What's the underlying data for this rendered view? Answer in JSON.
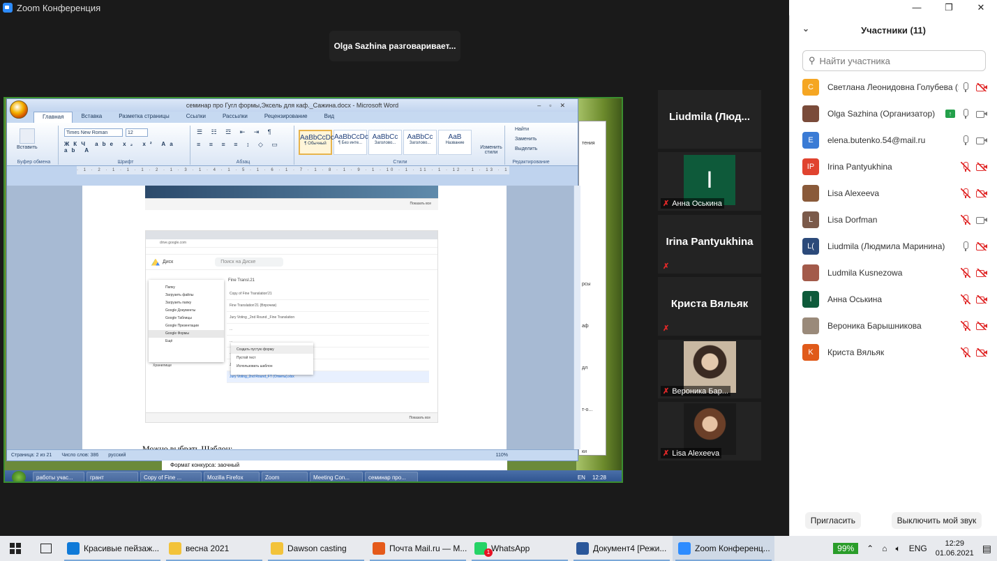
{
  "window": {
    "title": "Zoom Конференция",
    "controls": [
      "—",
      "❐",
      "✕"
    ]
  },
  "speaker_banner": "Olga Sazhina разговаривает...",
  "shared_screen": {
    "word_title": "семинар про Гугл формы,Эксель для каф._Сажина.docx - Microsoft Word",
    "ribbon_tabs": [
      "Главная",
      "Вставка",
      "Разметка страницы",
      "Ссылки",
      "Рассылки",
      "Рецензирование",
      "Вид"
    ],
    "clipboard_label": "Вставить",
    "group_labels": [
      "Буфер обмена",
      "Шрифт",
      "Абзац",
      "Стили",
      "Редактирование"
    ],
    "font_name": "Times New Roman",
    "font_size": "12",
    "styles": [
      {
        "preview": "AaBbCcDc",
        "name": "¶ Обычный"
      },
      {
        "preview": "AaBbCcDc",
        "name": "¶ Без инте..."
      },
      {
        "preview": "AaBbCc",
        "name": "Заголово..."
      },
      {
        "preview": "AaBbCc",
        "name": "Заголово..."
      },
      {
        "preview": "AaB",
        "name": "Название"
      }
    ],
    "change_styles": "Изменить стили",
    "editing": [
      "Найти",
      "Заменить",
      "Выделить"
    ],
    "drive": {
      "logo_text": "Диск",
      "search_placeholder": "Поиск на Диске",
      "breadcrumb": "Fine Transl.21",
      "menu": [
        "Папку",
        "Загрузить файлы",
        "Загрузить папку",
        "Google Документы",
        "Google Таблицы",
        "Google Презентации",
        "Google Формы",
        "Ещё"
      ],
      "submenu": [
        "Создать пустую форму",
        "Пустой тест",
        "Использовать шаблон"
      ],
      "rows": [
        "Copy of Fine Translation'21",
        "Fine Translation'21 (Впрочем)",
        "Jury Voting _2nd Round _Fine Translation",
        "...",
        "...",
        "...",
        "Jury Voting - Fine Translation (Ответы).xlsx",
        "Jury Voting_2nd Round_FT (Ответы).xlsx"
      ],
      "storage": "Хранилище",
      "download_bar": "Показать все"
    },
    "doc_text": "Можно выбрать Шаблон:",
    "status": {
      "page": "Страница: 2 из 21",
      "words": "Число слов: 386",
      "lang": "русский",
      "zoom": "110%"
    },
    "overlay_note": "Формат конкурса: заочный",
    "xp_taskbar": [
      "работы учас...",
      "грант",
      "Copy of Fine ...",
      "Mozilla Firefox",
      "Zoom",
      "Meeting Con...",
      "семинар про..."
    ],
    "xp_lang": "EN",
    "xp_time": "12:28"
  },
  "video_tiles": [
    {
      "name": "Liudmila  (Люд...",
      "label": "",
      "muted": false
    },
    {
      "name": "",
      "label": "Анна Оськина",
      "muted": true,
      "letter": "I"
    },
    {
      "name": "Irina Pantyukhina",
      "label": "",
      "muted": true
    },
    {
      "name": "Криста Вяльяк",
      "label": "",
      "muted": true
    },
    {
      "name": "",
      "label": "Вероника Бар...",
      "muted": true
    },
    {
      "name": "",
      "label": "Lisa Alexeeva",
      "muted": true
    }
  ],
  "participants_panel": {
    "title": "Участники (11)",
    "search_placeholder": "Найти участника",
    "participants": [
      {
        "initials": "С",
        "color": "#f5a623",
        "name": "Светлана Леонидовна Голубева (Я)",
        "mic": "on",
        "cam": "off"
      },
      {
        "initials": "",
        "color": "#7a4b3a",
        "name": "Olga Sazhina (Организатор)",
        "mic": "on",
        "cam": "on",
        "sharing": true
      },
      {
        "initials": "E",
        "color": "#3a7bd5",
        "name": "elena.butenko.54@mail.ru",
        "mic": "on",
        "cam": "on"
      },
      {
        "initials": "IP",
        "color": "#e0432f",
        "name": "Irina Pantyukhina",
        "mic": "off",
        "cam": "off"
      },
      {
        "initials": "",
        "color": "#8a5a3a",
        "name": "Lisa Alexeeva",
        "mic": "off",
        "cam": "off"
      },
      {
        "initials": "L",
        "color": "#7b5a4a",
        "name": "Lisa Dorfman",
        "mic": "off",
        "cam": "on"
      },
      {
        "initials": "L(",
        "color": "#2c4a7a",
        "name": "Liudmila (Людмила Маринина)",
        "mic": "on",
        "cam": "off"
      },
      {
        "initials": "",
        "color": "#a35a4a",
        "name": "Ludmila Kusnezowa",
        "mic": "off",
        "cam": "off"
      },
      {
        "initials": "I",
        "color": "#0e5a3a",
        "name": "Анна Оськина",
        "mic": "off",
        "cam": "off"
      },
      {
        "initials": "",
        "color": "#9a8a7a",
        "name": "Вероника Барышникова",
        "mic": "off",
        "cam": "off"
      },
      {
        "initials": "K",
        "color": "#e05a1a",
        "name": "Криста Вяльяк",
        "mic": "off",
        "cam": "off"
      }
    ],
    "invite_button": "Пригласить",
    "unmute_button": "Выключить мой звук"
  },
  "taskbar": {
    "items": [
      {
        "label": "Красивые пейзаж...",
        "icon_color": "#0f7ad8"
      },
      {
        "label": "весна 2021",
        "icon_color": "#f3c33a"
      },
      {
        "label": "Dawson casting",
        "icon_color": "#f3c33a"
      },
      {
        "label": "Почта Mail.ru — M...",
        "icon_color": "#e55a1a"
      },
      {
        "label": "WhatsApp",
        "icon_color": "#25d366",
        "badge": "1"
      },
      {
        "label": "Документ4 [Режи...",
        "icon_color": "#2b579a"
      },
      {
        "label": "Zoom Конференц...",
        "icon_color": "#2d8cff",
        "active": true
      }
    ],
    "battery": "99%",
    "lang": "ENG",
    "time": "12:29",
    "date": "01.06.2021"
  }
}
